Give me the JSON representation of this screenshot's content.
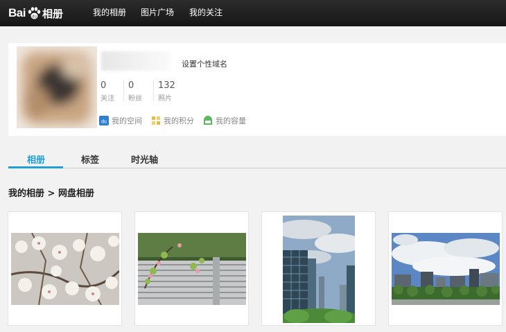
{
  "header": {
    "logo_text": "Bai",
    "logo_suffix": "相册",
    "nav": [
      "我的相册",
      "图片广场",
      "我的关注"
    ]
  },
  "profile": {
    "set_domain": "设置个性域名",
    "stats": [
      {
        "value": "0",
        "label": "关注"
      },
      {
        "value": "0",
        "label": "粉丝"
      },
      {
        "value": "132",
        "label": "照片"
      }
    ],
    "links": [
      "我的空间",
      "我的积分",
      "我的容量"
    ]
  },
  "tabs": [
    "相册",
    "标签",
    "时光轴"
  ],
  "breadcrumb": "我的相册 > 网盘相册",
  "photos": [
    {
      "subject": "cherry-blossom"
    },
    {
      "subject": "fence-with-flowers"
    },
    {
      "subject": "glass-towers-portrait"
    },
    {
      "subject": "city-skyline-clouds"
    }
  ],
  "colors": {
    "accent": "#1f9fd9",
    "topbar": "#1c1c1c"
  }
}
